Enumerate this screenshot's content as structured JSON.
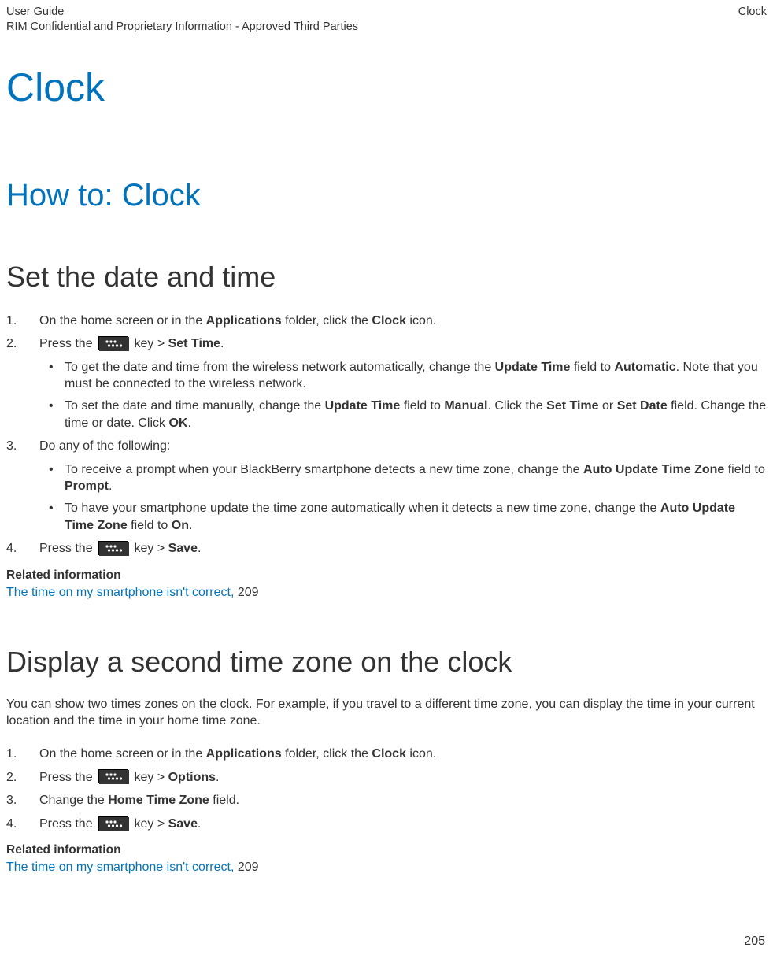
{
  "header": {
    "left_line1": "User Guide",
    "left_line2": "RIM Confidential and Proprietary Information - Approved Third Parties",
    "right": "Clock"
  },
  "title": "Clock",
  "section1": {
    "heading": "How to: Clock",
    "sub1": {
      "heading": "Set the date and time",
      "step1_a": "On the home screen or in the ",
      "step1_b": "Applications",
      "step1_c": " folder, click the ",
      "step1_d": "Clock",
      "step1_e": " icon.",
      "step2_a": "Press the ",
      "step2_b": " key > ",
      "step2_c": "Set Time",
      "step2_d": ".",
      "bullet2a_a": "To get the date and time from the wireless network automatically, change the ",
      "bullet2a_b": "Update Time",
      "bullet2a_c": " field to ",
      "bullet2a_d": "Automatic",
      "bullet2a_e": ". Note that you must be connected to the wireless network.",
      "bullet2b_a": "To set the date and time manually, change the ",
      "bullet2b_b": "Update Time",
      "bullet2b_c": " field to ",
      "bullet2b_d": "Manual",
      "bullet2b_e": ". Click the ",
      "bullet2b_f": "Set Time",
      "bullet2b_g": " or ",
      "bullet2b_h": "Set Date",
      "bullet2b_i": " field. Change the time or date. Click ",
      "bullet2b_j": "OK",
      "bullet2b_k": ".",
      "step3": "Do any of the following:",
      "bullet3a_a": "To receive a prompt when your BlackBerry smartphone detects a new time zone, change the ",
      "bullet3a_b": "Auto Update Time Zone",
      "bullet3a_c": " field to ",
      "bullet3a_d": "Prompt",
      "bullet3a_e": ".",
      "bullet3b_a": "To have your smartphone update the time zone automatically when it detects a new time zone, change the ",
      "bullet3b_b": "Auto Update Time Zone",
      "bullet3b_c": " field to ",
      "bullet3b_d": "On",
      "bullet3b_e": ".",
      "step4_a": " Press the ",
      "step4_b": " key > ",
      "step4_c": "Save",
      "step4_d": ".",
      "related_heading": "Related information",
      "related_link": "The time on my smartphone isn't correct, ",
      "related_page": "209"
    },
    "sub2": {
      "heading": "Display a second time zone on the clock",
      "intro": "You can show two times zones on the clock. For example, if you travel to a different time zone, you can display the time in your current location and the time in your home time zone.",
      "step1_a": "On the home screen or in the ",
      "step1_b": "Applications",
      "step1_c": " folder, click the ",
      "step1_d": "Clock",
      "step1_e": " icon.",
      "step2_a": " Press the ",
      "step2_b": " key > ",
      "step2_c": "Options",
      "step2_d": ".",
      "step3_a": "Change the ",
      "step3_b": "Home Time Zone",
      "step3_c": " field.",
      "step4_a": " Press the ",
      "step4_b": " key > ",
      "step4_c": "Save",
      "step4_d": ".",
      "related_heading": "Related information",
      "related_link": "The time on my smartphone isn't correct, ",
      "related_page": "209"
    }
  },
  "page_number": "205"
}
